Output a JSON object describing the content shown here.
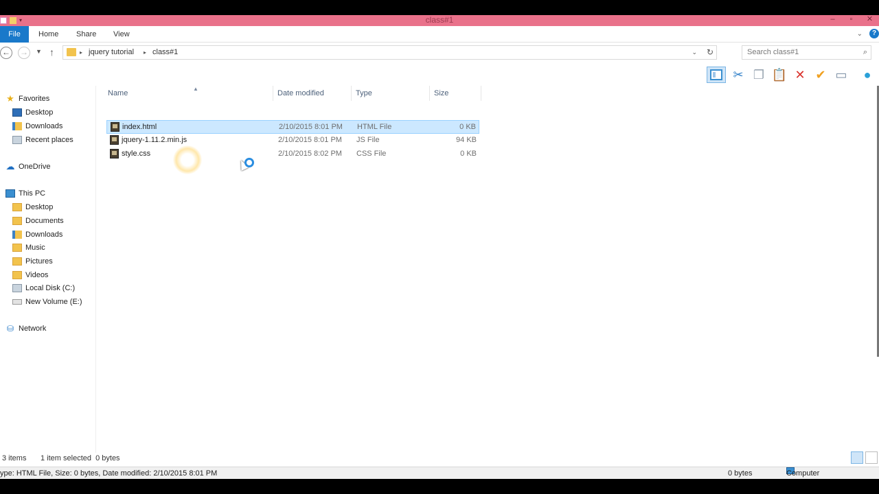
{
  "window": {
    "title": "class#1",
    "controls": {
      "minimize": "–",
      "maximize": "▫",
      "close": "✕"
    }
  },
  "ribbon": {
    "file_tab": "File",
    "tabs": [
      "Home",
      "Share",
      "View"
    ]
  },
  "address_bar": {
    "breadcrumbs": [
      "jquery tutorial",
      "class#1"
    ]
  },
  "search": {
    "placeholder": "Search class#1"
  },
  "toolbar": {
    "icons": [
      "navigation-pane-icon",
      "cut-icon",
      "copy-icon",
      "paste-icon",
      "delete-icon",
      "check-icon",
      "rename-icon",
      "properties-icon"
    ]
  },
  "nav_pane": {
    "items": [
      {
        "label": "Favorites",
        "icon": "star-icon"
      },
      {
        "label": "Desktop",
        "icon": "desktop-icon"
      },
      {
        "label": "Downloads",
        "icon": "downloads-icon"
      },
      {
        "label": "Recent places",
        "icon": "recent-places-icon"
      },
      {
        "label": "OneDrive",
        "icon": "onedrive-icon"
      },
      {
        "label": "This PC",
        "icon": "computer-icon"
      },
      {
        "label": "Desktop",
        "icon": "desktop-icon"
      },
      {
        "label": "Documents",
        "icon": "documents-icon"
      },
      {
        "label": "Downloads",
        "icon": "downloads-icon"
      },
      {
        "label": "Music",
        "icon": "music-icon"
      },
      {
        "label": "Pictures",
        "icon": "pictures-icon"
      },
      {
        "label": "Videos",
        "icon": "videos-icon"
      },
      {
        "label": "Local Disk (C:)",
        "icon": "local-disk-icon"
      },
      {
        "label": "New Volume (E:)",
        "icon": "drive-icon"
      },
      {
        "label": "Network",
        "icon": "network-icon"
      }
    ]
  },
  "file_list": {
    "columns": [
      "Name",
      "Date modified",
      "Type",
      "Size"
    ],
    "rows": [
      {
        "name": "index.html",
        "date": "2/10/2015 8:01 PM",
        "type": "HTML File",
        "size": "0 KB",
        "selected": true
      },
      {
        "name": "jquery-1.11.2.min.js",
        "date": "2/10/2015 8:01 PM",
        "type": "JS File",
        "size": "94 KB",
        "selected": false
      },
      {
        "name": "style.css",
        "date": "2/10/2015 8:02 PM",
        "type": "CSS File",
        "size": "0 KB",
        "selected": false
      }
    ]
  },
  "status": {
    "item_count": "3 items",
    "selection": "1 item selected  0 bytes"
  },
  "details_bar": {
    "info": "ype: HTML File, Size: 0 bytes, Date modified: 2/10/2015 8:01 PM",
    "size": "0 bytes",
    "location": "Computer"
  },
  "colors": {
    "titlebar": "#e9718a",
    "file_tab": "#1979ca",
    "selection": "#cce8ff"
  }
}
